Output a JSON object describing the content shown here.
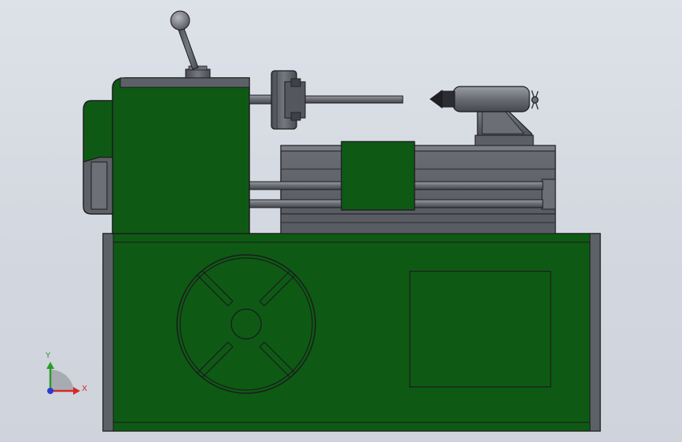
{
  "viewport": {
    "background": "#d5d9e1"
  },
  "model": {
    "body_color": "#0e5a14",
    "metal_color": "#5e6068",
    "edge_color": "#1b1b1e"
  },
  "triad": {
    "x_label": "X",
    "y_label": "Y",
    "x_color": "#d42a2a",
    "y_color": "#2a9a2a",
    "z_color": "#2a3ad4"
  }
}
